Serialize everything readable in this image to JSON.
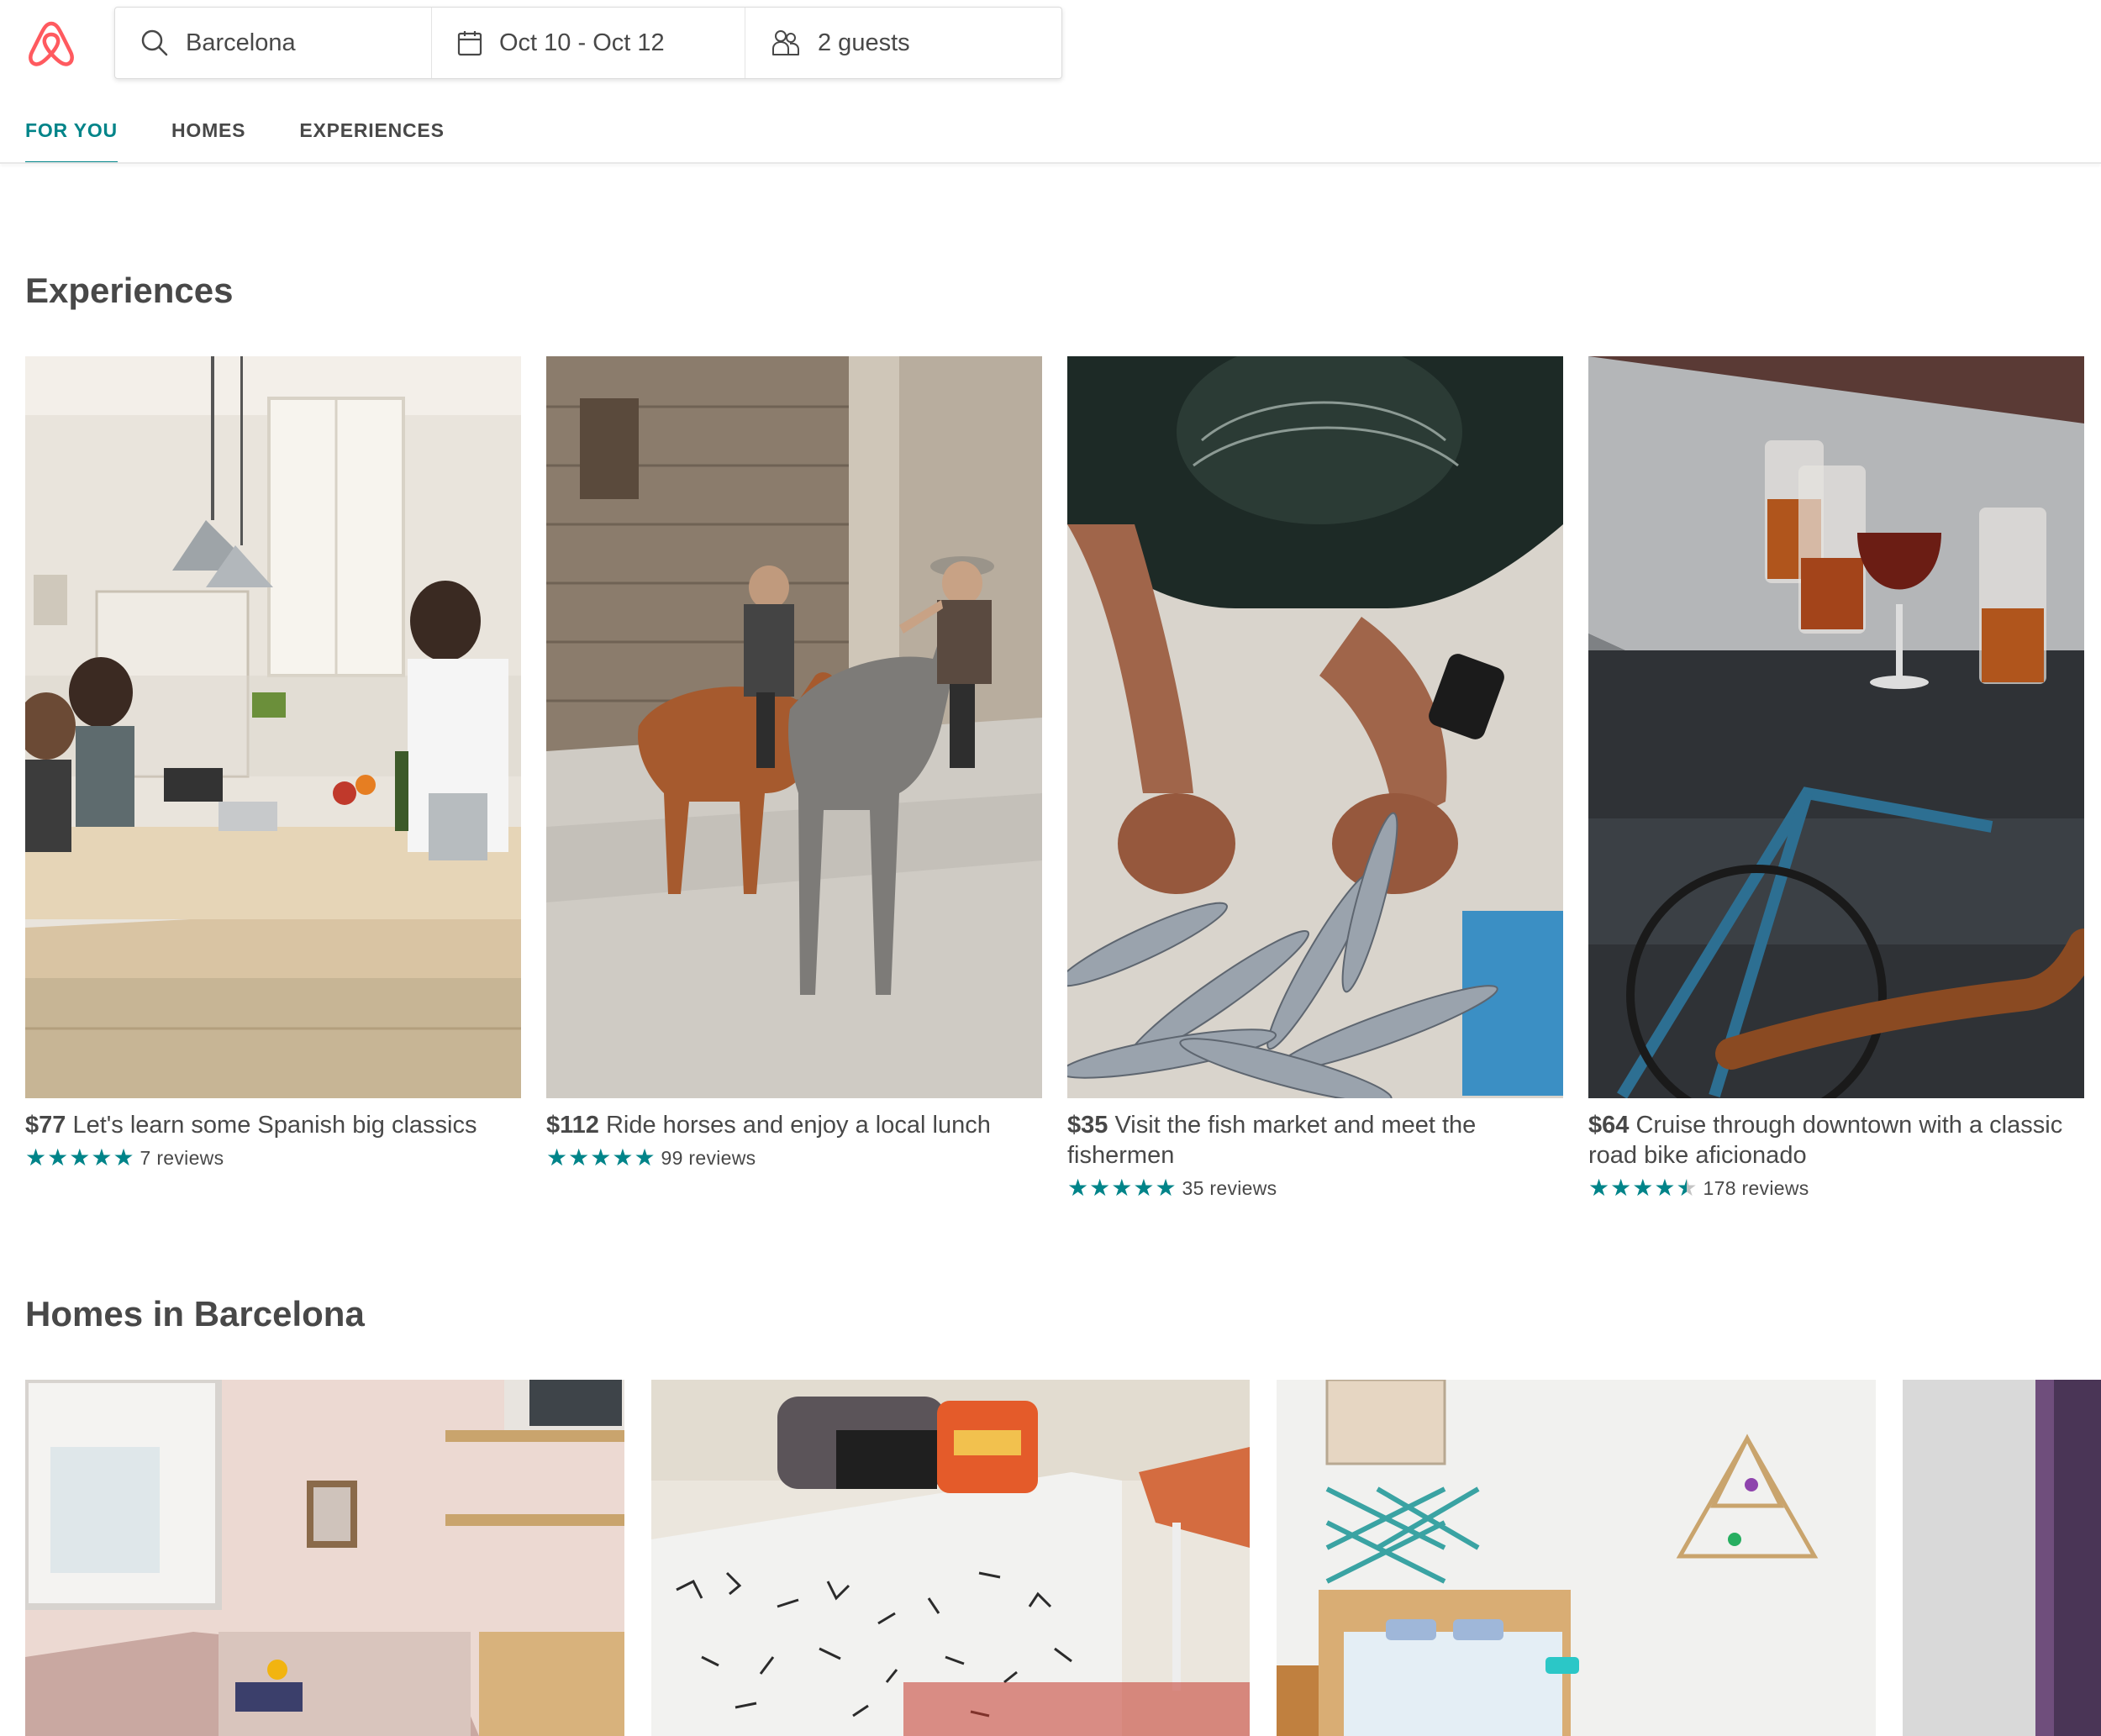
{
  "header": {
    "logo": "airbnb-belo-logo",
    "search": {
      "location": "Barcelona",
      "dates": "Oct 10 - Oct 12",
      "guests": "2 guests"
    },
    "tabs": [
      {
        "label": "FOR YOU",
        "active": true
      },
      {
        "label": "HOMES",
        "active": false
      },
      {
        "label": "EXPERIENCES",
        "active": false
      }
    ]
  },
  "experiences": {
    "title": "Experiences",
    "items": [
      {
        "price": "$77",
        "title": "Let's learn some Spanish big classics",
        "rating": 5,
        "reviews": "7 reviews"
      },
      {
        "price": "$112",
        "title": "Ride horses and enjoy a local lunch",
        "rating": 5,
        "reviews": "99 reviews"
      },
      {
        "price": "$35",
        "title": "Visit the fish market and meet the fishermen",
        "rating": 5,
        "reviews": "35 reviews"
      },
      {
        "price": "$64",
        "title": "Cruise through downtown with a classic road bike aficionado",
        "rating": 4.5,
        "reviews": "178 reviews"
      }
    ]
  },
  "homes": {
    "title": "Homes in Barcelona"
  },
  "colors": {
    "brand": "#FF5A5F",
    "accent": "#008489",
    "text": "#484848"
  }
}
